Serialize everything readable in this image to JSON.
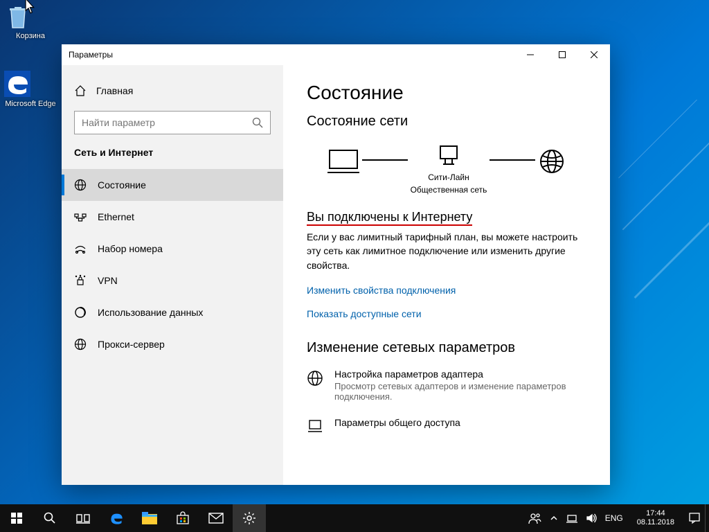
{
  "desktop": {
    "recycle": "Корзина",
    "edge": "Microsoft Edge"
  },
  "window": {
    "title": "Параметры"
  },
  "sidebar": {
    "home": "Главная",
    "search_placeholder": "Найти параметр",
    "category": "Сеть и Интернет",
    "items": [
      {
        "label": "Состояние"
      },
      {
        "label": "Ethernet"
      },
      {
        "label": "Набор номера"
      },
      {
        "label": "VPN"
      },
      {
        "label": "Использование данных"
      },
      {
        "label": "Прокси-сервер"
      }
    ]
  },
  "content": {
    "h1": "Состояние",
    "h2": "Состояние сети",
    "net_name": "Сити-Лайн",
    "net_type": "Общественная сеть",
    "status_title": "Вы подключены к Интернету",
    "status_body": "Если у вас лимитный тарифный план, вы можете настроить эту сеть как лимитное подключение или изменить другие свойства.",
    "link1": "Изменить свойства подключения",
    "link2": "Показать доступные сети",
    "h3": "Изменение сетевых параметров",
    "adapter_title": "Настройка параметров адаптера",
    "adapter_sub": "Просмотр сетевых адаптеров и изменение параметров подключения.",
    "sharing_title": "Параметры общего доступа"
  },
  "tray": {
    "lang": "ENG",
    "time": "17:44",
    "date": "08.11.2018"
  }
}
